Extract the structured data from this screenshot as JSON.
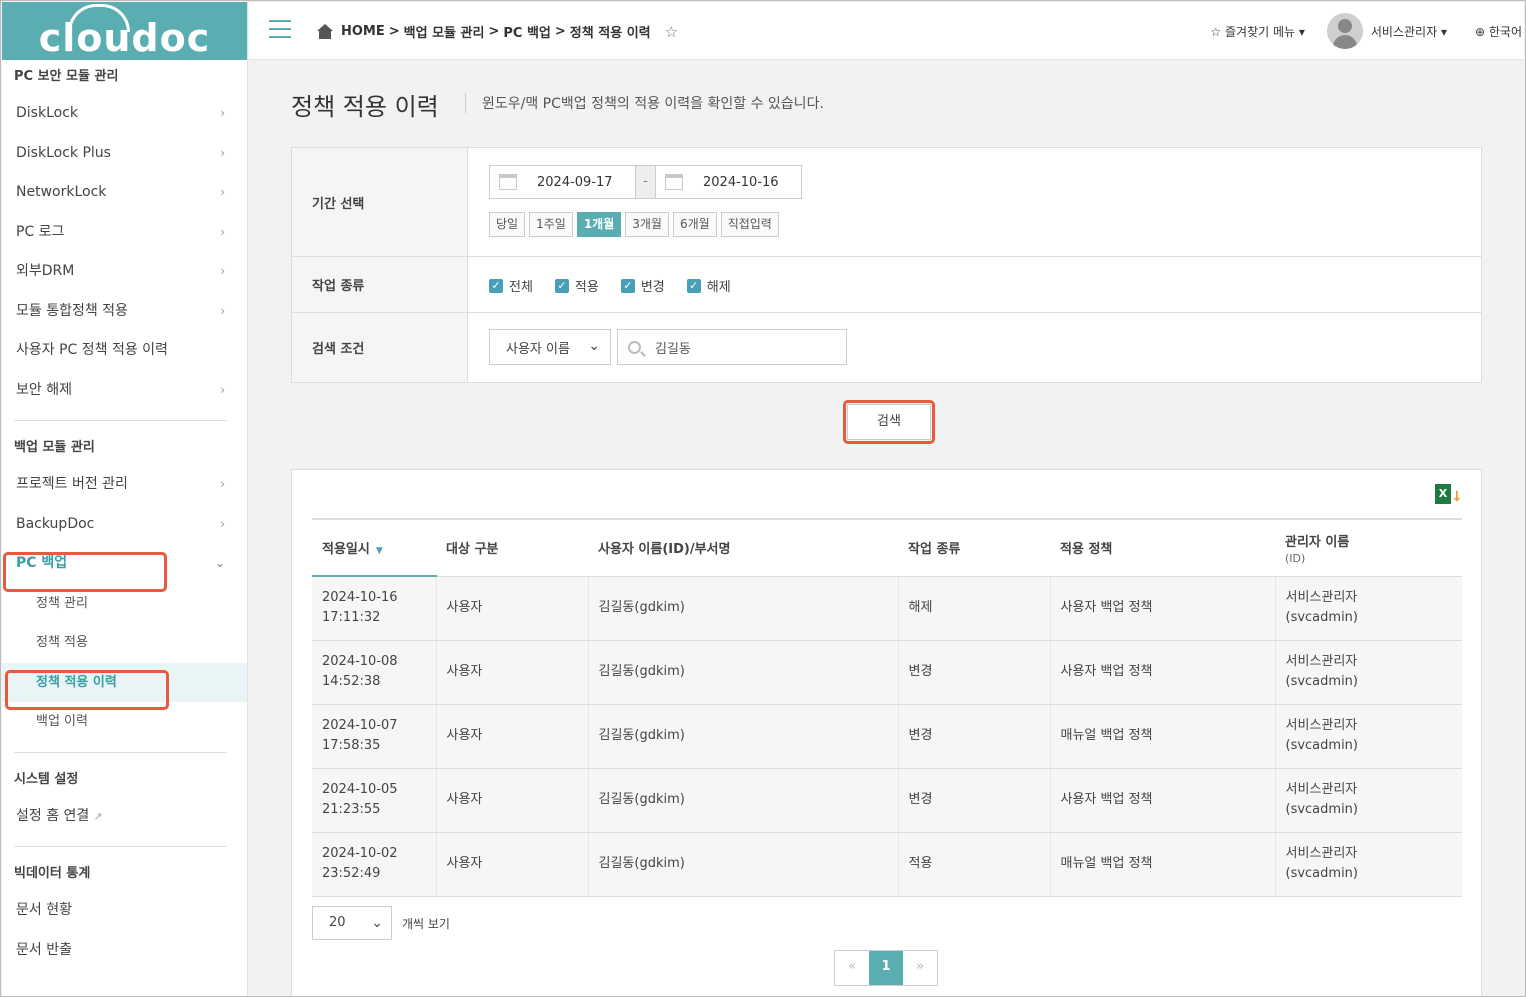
{
  "app": {
    "logo_text": "cloudoc"
  },
  "sidebar": {
    "section1": "PC 보안 모듈 관리",
    "items1": [
      {
        "label": "DiskLock"
      },
      {
        "label": "DiskLock Plus"
      },
      {
        "label": "NetworkLock"
      },
      {
        "label": "PC 로그"
      },
      {
        "label": "외부DRM"
      },
      {
        "label": "모듈 통합정책 적용"
      },
      {
        "label": "사용자 PC 정책 적용 이력"
      },
      {
        "label": "보안 해제"
      }
    ],
    "section2": "백업 모듈 관리",
    "items2": [
      {
        "label": "프로젝트 버전 관리"
      },
      {
        "label": "BackupDoc"
      },
      {
        "label": "PC 백업"
      }
    ],
    "sub_items": [
      {
        "label": "정책 관리"
      },
      {
        "label": "정책 적용"
      },
      {
        "label": "정책 적용 이력"
      },
      {
        "label": "백업 이력"
      }
    ],
    "section3": "시스템 설정",
    "settings_link": "설정 홈 연결",
    "section4": "빅데이터 통계",
    "items4": [
      {
        "label": "문서 현황"
      },
      {
        "label": "문서 반출"
      }
    ]
  },
  "topbar": {
    "breadcrumb": [
      "HOME",
      ">",
      "백업 모듈 관리",
      ">",
      "PC 백업",
      ">",
      "정책 적용 이력"
    ],
    "favorites": "즐겨찾기 메뉴 ▾",
    "user": "서비스관리자 ▾",
    "language": "한국어"
  },
  "page": {
    "title": "정책 적용 이력",
    "description": "윈도우/맥 PC백업 정책의 적용 이력을 확인할 수 있습니다."
  },
  "filter": {
    "period_label": "기간 선택",
    "start_date": "2024-09-17",
    "date_separator": "-",
    "end_date": "2024-10-16",
    "periods": [
      "당일",
      "1주일",
      "1개월",
      "3개월",
      "6개월",
      "직접입력"
    ],
    "active_period": "1개월",
    "type_label": "작업 종류",
    "types": [
      "전체",
      "적용",
      "변경",
      "해제"
    ],
    "condition_label": "검색 조건",
    "condition_select": "사용자 이름",
    "search_value": "김길동",
    "search_button": "검색"
  },
  "table": {
    "headers": [
      "적용일시",
      "대상 구분",
      "사용자 이름(ID)/부서명",
      "작업 종류",
      "적용 정책",
      "관리자 이름"
    ],
    "admin_sub": "(ID)",
    "rows": [
      {
        "date": "2024-10-16",
        "time": "17:11:32",
        "target": "사용자",
        "user": "김길동(gdkim)",
        "action": "해제",
        "policy": "사용자 백업 정책",
        "admin": "서비스관리자",
        "admin_id": "(svcadmin)"
      },
      {
        "date": "2024-10-08",
        "time": "14:52:38",
        "target": "사용자",
        "user": "김길동(gdkim)",
        "action": "변경",
        "policy": "사용자 백업 정책",
        "admin": "서비스관리자",
        "admin_id": "(svcadmin)"
      },
      {
        "date": "2024-10-07",
        "time": "17:58:35",
        "target": "사용자",
        "user": "김길동(gdkim)",
        "action": "변경",
        "policy": "매뉴얼 백업 정책",
        "admin": "서비스관리자",
        "admin_id": "(svcadmin)"
      },
      {
        "date": "2024-10-05",
        "time": "21:23:55",
        "target": "사용자",
        "user": "김길동(gdkim)",
        "action": "변경",
        "policy": "사용자 백업 정책",
        "admin": "서비스관리자",
        "admin_id": "(svcadmin)"
      },
      {
        "date": "2024-10-02",
        "time": "23:52:49",
        "target": "사용자",
        "user": "김길동(gdkim)",
        "action": "적용",
        "policy": "매뉴얼 백업 정책",
        "admin": "서비스관리자",
        "admin_id": "(svcadmin)"
      }
    ]
  },
  "pager": {
    "per_page": "20",
    "per_page_label": "개씩 보기",
    "prev": "«",
    "current": "1",
    "next": "»"
  },
  "colors": {
    "brand": "#5aaeb2",
    "highlight": "#e85a3c",
    "checkbox": "#4a9fb8"
  }
}
